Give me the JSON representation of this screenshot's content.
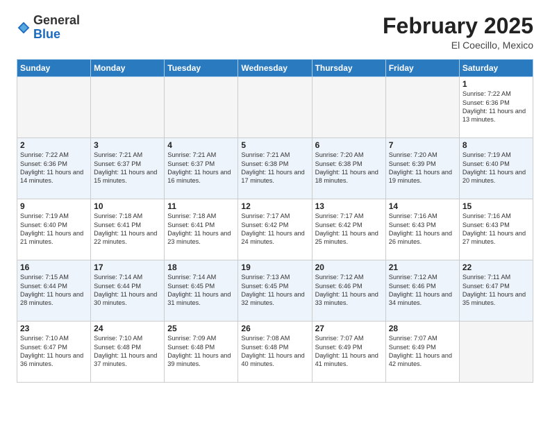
{
  "header": {
    "logo_general": "General",
    "logo_blue": "Blue",
    "month_title": "February 2025",
    "subtitle": "El Coecillo, Mexico"
  },
  "weekdays": [
    "Sunday",
    "Monday",
    "Tuesday",
    "Wednesday",
    "Thursday",
    "Friday",
    "Saturday"
  ],
  "weeks": [
    [
      {
        "day": "",
        "info": ""
      },
      {
        "day": "",
        "info": ""
      },
      {
        "day": "",
        "info": ""
      },
      {
        "day": "",
        "info": ""
      },
      {
        "day": "",
        "info": ""
      },
      {
        "day": "",
        "info": ""
      },
      {
        "day": "1",
        "info": "Sunrise: 7:22 AM\nSunset: 6:36 PM\nDaylight: 11 hours\nand 13 minutes."
      }
    ],
    [
      {
        "day": "2",
        "info": "Sunrise: 7:22 AM\nSunset: 6:36 PM\nDaylight: 11 hours\nand 14 minutes."
      },
      {
        "day": "3",
        "info": "Sunrise: 7:21 AM\nSunset: 6:37 PM\nDaylight: 11 hours\nand 15 minutes."
      },
      {
        "day": "4",
        "info": "Sunrise: 7:21 AM\nSunset: 6:37 PM\nDaylight: 11 hours\nand 16 minutes."
      },
      {
        "day": "5",
        "info": "Sunrise: 7:21 AM\nSunset: 6:38 PM\nDaylight: 11 hours\nand 17 minutes."
      },
      {
        "day": "6",
        "info": "Sunrise: 7:20 AM\nSunset: 6:38 PM\nDaylight: 11 hours\nand 18 minutes."
      },
      {
        "day": "7",
        "info": "Sunrise: 7:20 AM\nSunset: 6:39 PM\nDaylight: 11 hours\nand 19 minutes."
      },
      {
        "day": "8",
        "info": "Sunrise: 7:19 AM\nSunset: 6:40 PM\nDaylight: 11 hours\nand 20 minutes."
      }
    ],
    [
      {
        "day": "9",
        "info": "Sunrise: 7:19 AM\nSunset: 6:40 PM\nDaylight: 11 hours\nand 21 minutes."
      },
      {
        "day": "10",
        "info": "Sunrise: 7:18 AM\nSunset: 6:41 PM\nDaylight: 11 hours\nand 22 minutes."
      },
      {
        "day": "11",
        "info": "Sunrise: 7:18 AM\nSunset: 6:41 PM\nDaylight: 11 hours\nand 23 minutes."
      },
      {
        "day": "12",
        "info": "Sunrise: 7:17 AM\nSunset: 6:42 PM\nDaylight: 11 hours\nand 24 minutes."
      },
      {
        "day": "13",
        "info": "Sunrise: 7:17 AM\nSunset: 6:42 PM\nDaylight: 11 hours\nand 25 minutes."
      },
      {
        "day": "14",
        "info": "Sunrise: 7:16 AM\nSunset: 6:43 PM\nDaylight: 11 hours\nand 26 minutes."
      },
      {
        "day": "15",
        "info": "Sunrise: 7:16 AM\nSunset: 6:43 PM\nDaylight: 11 hours\nand 27 minutes."
      }
    ],
    [
      {
        "day": "16",
        "info": "Sunrise: 7:15 AM\nSunset: 6:44 PM\nDaylight: 11 hours\nand 28 minutes."
      },
      {
        "day": "17",
        "info": "Sunrise: 7:14 AM\nSunset: 6:44 PM\nDaylight: 11 hours\nand 30 minutes."
      },
      {
        "day": "18",
        "info": "Sunrise: 7:14 AM\nSunset: 6:45 PM\nDaylight: 11 hours\nand 31 minutes."
      },
      {
        "day": "19",
        "info": "Sunrise: 7:13 AM\nSunset: 6:45 PM\nDaylight: 11 hours\nand 32 minutes."
      },
      {
        "day": "20",
        "info": "Sunrise: 7:12 AM\nSunset: 6:46 PM\nDaylight: 11 hours\nand 33 minutes."
      },
      {
        "day": "21",
        "info": "Sunrise: 7:12 AM\nSunset: 6:46 PM\nDaylight: 11 hours\nand 34 minutes."
      },
      {
        "day": "22",
        "info": "Sunrise: 7:11 AM\nSunset: 6:47 PM\nDaylight: 11 hours\nand 35 minutes."
      }
    ],
    [
      {
        "day": "23",
        "info": "Sunrise: 7:10 AM\nSunset: 6:47 PM\nDaylight: 11 hours\nand 36 minutes."
      },
      {
        "day": "24",
        "info": "Sunrise: 7:10 AM\nSunset: 6:48 PM\nDaylight: 11 hours\nand 37 minutes."
      },
      {
        "day": "25",
        "info": "Sunrise: 7:09 AM\nSunset: 6:48 PM\nDaylight: 11 hours\nand 39 minutes."
      },
      {
        "day": "26",
        "info": "Sunrise: 7:08 AM\nSunset: 6:48 PM\nDaylight: 11 hours\nand 40 minutes."
      },
      {
        "day": "27",
        "info": "Sunrise: 7:07 AM\nSunset: 6:49 PM\nDaylight: 11 hours\nand 41 minutes."
      },
      {
        "day": "28",
        "info": "Sunrise: 7:07 AM\nSunset: 6:49 PM\nDaylight: 11 hours\nand 42 minutes."
      },
      {
        "day": "",
        "info": ""
      }
    ]
  ]
}
